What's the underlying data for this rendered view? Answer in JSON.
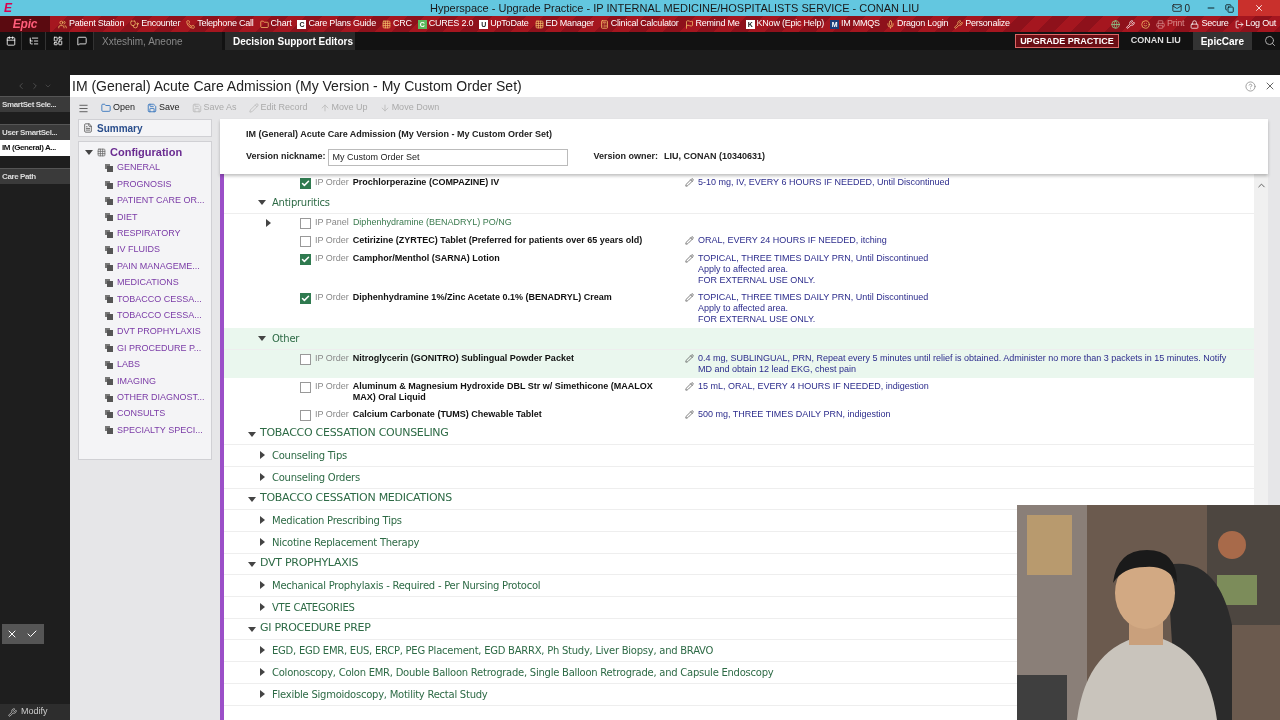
{
  "title_bar": {
    "title": "Hyperspace - Upgrade Practice - IP INTERNAL MEDICINE/HOSPITALISTS  SERVICE - CONAN LIU",
    "logo": "E",
    "mail_count": "0"
  },
  "epic_toolbar": {
    "logo": "Epic",
    "items": [
      {
        "label": "Patient Station"
      },
      {
        "label": "Encounter"
      },
      {
        "label": "Telephone Call"
      },
      {
        "label": "Chart"
      },
      {
        "label": "Care Plans Guide",
        "badge": "C"
      },
      {
        "label": "CRC"
      },
      {
        "label": "CURES 2.0",
        "badge": "C"
      },
      {
        "label": "UpToDate",
        "badge": "U"
      },
      {
        "label": "ED Manager"
      },
      {
        "label": "Clinical Calculator"
      },
      {
        "label": "Remind Me"
      },
      {
        "label": "KNow (Epic Help)",
        "badge": "K"
      },
      {
        "label": "IM MMQS",
        "badge": "M"
      },
      {
        "label": "Dragon Login"
      },
      {
        "label": "Personalize"
      }
    ],
    "right_items": [
      {
        "label": "Print",
        "disabled": true
      },
      {
        "label": "Secure",
        "disabled": false
      },
      {
        "label": "Log Out",
        "disabled": false
      }
    ]
  },
  "tabs": [
    {
      "label": "Xxteshim, Aneone",
      "selected": false
    },
    {
      "label": "Decision Support Editors",
      "selected": true
    }
  ],
  "environment": {
    "badge": "UPGRADE PRACTICE",
    "user": "CONAN LIU",
    "app": "EpicCare"
  },
  "nav": {
    "items": [
      {
        "label": "SmartSet Sele...",
        "selected": false
      },
      {
        "label": "User SmartSel...",
        "selected": false
      },
      {
        "label": "IM (General) A...",
        "selected": true
      },
      {
        "label": "Care Path",
        "selected": false
      }
    ],
    "footer": "Modify"
  },
  "window": {
    "title": "IM (General) Acute Care Admission (My Version - My Custom Order Set)"
  },
  "toolbar": [
    {
      "label": "Open",
      "disabled": false
    },
    {
      "label": "Save",
      "disabled": false
    },
    {
      "label": "Save As",
      "disabled": true
    },
    {
      "label": "Edit Record",
      "disabled": true
    },
    {
      "label": "Move Up",
      "disabled": true
    },
    {
      "label": "Move Down",
      "disabled": true
    }
  ],
  "outline": {
    "summary": "Summary",
    "root": "Configuration",
    "expanded": true,
    "items": [
      "GENERAL",
      "PROGNOSIS",
      "PATIENT CARE OR...",
      "DIET",
      "RESPIRATORY",
      "IV FLUIDS",
      "PAIN MANAGEME...",
      "MEDICATIONS",
      "TOBACCO CESSA...",
      "TOBACCO CESSA...",
      "DVT PROPHYLAXIS",
      "GI PROCEDURE P...",
      "LABS",
      "IMAGING",
      "OTHER DIAGNOST...",
      "CONSULTS",
      "SPECIALTY SPECI..."
    ]
  },
  "header": {
    "title": "IM (General) Acute Care Admission (My Version - My Custom Order Set)",
    "nickname_label": "Version nickname:",
    "nickname": "My Custom Order Set",
    "owner_label": "Version owner:",
    "owner": "LIU, CONAN (10340631)"
  },
  "content": [
    {
      "kind": "order",
      "checked": true,
      "type": "IP Order",
      "name": "Prochlorperazine (COMPAZINE) IV",
      "sig": [
        "5-10 mg, IV, EVERY 6 HOURS IF NEEDED, Until Discontinued"
      ]
    },
    {
      "kind": "group",
      "label": "Antipruritics",
      "expanded": true,
      "highlighted": false,
      "children": [
        {
          "kind": "panel",
          "checked": false,
          "type": "IP Panel",
          "name": "Diphenhydramine (BENADRYL) PO/NG"
        },
        {
          "kind": "order",
          "checked": false,
          "type": "IP Order",
          "name": "Cetirizine (ZYRTEC) Tablet (Preferred for patients over 65 years old)",
          "sig": [
            "ORAL, EVERY 24 HOURS IF NEEDED, itching"
          ]
        },
        {
          "kind": "order",
          "checked": true,
          "type": "IP Order",
          "name": "Camphor/Menthol (SARNA) Lotion",
          "sig": [
            "TOPICAL, THREE TIMES DAILY PRN, Until Discontinued",
            "Apply to affected area.",
            "FOR EXTERNAL USE ONLY."
          ]
        },
        {
          "kind": "order",
          "checked": true,
          "type": "IP Order",
          "name": "Diphenhydramine 1%/Zinc Acetate 0.1% (BENADRYL) Cream",
          "sig": [
            "TOPICAL, THREE TIMES DAILY PRN, Until Discontinued",
            "Apply to affected area.",
            "FOR EXTERNAL USE ONLY."
          ]
        }
      ]
    },
    {
      "kind": "group",
      "label": "Other",
      "expanded": true,
      "highlighted": true,
      "children": [
        {
          "kind": "order",
          "checked": false,
          "highlighted": true,
          "type": "IP Order",
          "name": "Nitroglycerin (GONITRO) Sublingual Powder Packet",
          "sig": [
            "0.4 mg, SUBLINGUAL, PRN, Repeat every 5 minutes until relief is obtained. Administer no more than 3 packets in 15 minutes. Notify MD and obtain 12 lead EKG, chest pain"
          ]
        },
        {
          "kind": "order",
          "checked": false,
          "highlighted": false,
          "type": "IP Order",
          "name": "Aluminum & Magnesium Hydroxide DBL Str w/ Simethicone (MAALOX MAX) Oral Liquid",
          "sig": [
            "15 mL, ORAL, EVERY 4 HOURS IF NEEDED, indigestion"
          ]
        },
        {
          "kind": "order",
          "checked": false,
          "highlighted": false,
          "type": "IP Order",
          "name": "Calcium Carbonate (TUMS) Chewable Tablet",
          "sig": [
            "500 mg, THREE TIMES DAILY PRN, indigestion"
          ]
        }
      ]
    },
    {
      "kind": "section",
      "label": "TOBACCO CESSATION COUNSELING",
      "expanded": true,
      "children": [
        {
          "kind": "group",
          "label": "Counseling Tips",
          "expanded": false
        },
        {
          "kind": "group",
          "label": "Counseling Orders",
          "expanded": false
        }
      ]
    },
    {
      "kind": "section",
      "label": "TOBACCO CESSATION MEDICATIONS",
      "expanded": true,
      "children": [
        {
          "kind": "group",
          "label": "Medication Prescribing Tips",
          "expanded": false
        },
        {
          "kind": "group",
          "label": "Nicotine Replacement Therapy",
          "expanded": false
        }
      ]
    },
    {
      "kind": "section",
      "label": "DVT PROPHYLAXIS",
      "expanded": true,
      "children": [
        {
          "kind": "group",
          "label": "Mechanical Prophylaxis - Required - Per Nursing Protocol",
          "expanded": false
        },
        {
          "kind": "group",
          "label": "VTE CATEGORIES",
          "expanded": false
        }
      ]
    },
    {
      "kind": "section",
      "label": "GI PROCEDURE PREP",
      "expanded": true,
      "children": [
        {
          "kind": "group",
          "label": "EGD, EGD EMR, EUS, ERCP, PEG Placement, EGD BARRX, Ph Study, Liver Biopsy, and BRAVO",
          "expanded": false
        },
        {
          "kind": "group",
          "label": "Colonoscopy, Colon EMR, Double Balloon Retrograde, Single Balloon Retrograde, and Capsule Endoscopy",
          "expanded": false
        },
        {
          "kind": "group",
          "label": "Flexible Sigmoidoscopy, Motility Rectal Study",
          "expanded": false
        }
      ]
    }
  ]
}
